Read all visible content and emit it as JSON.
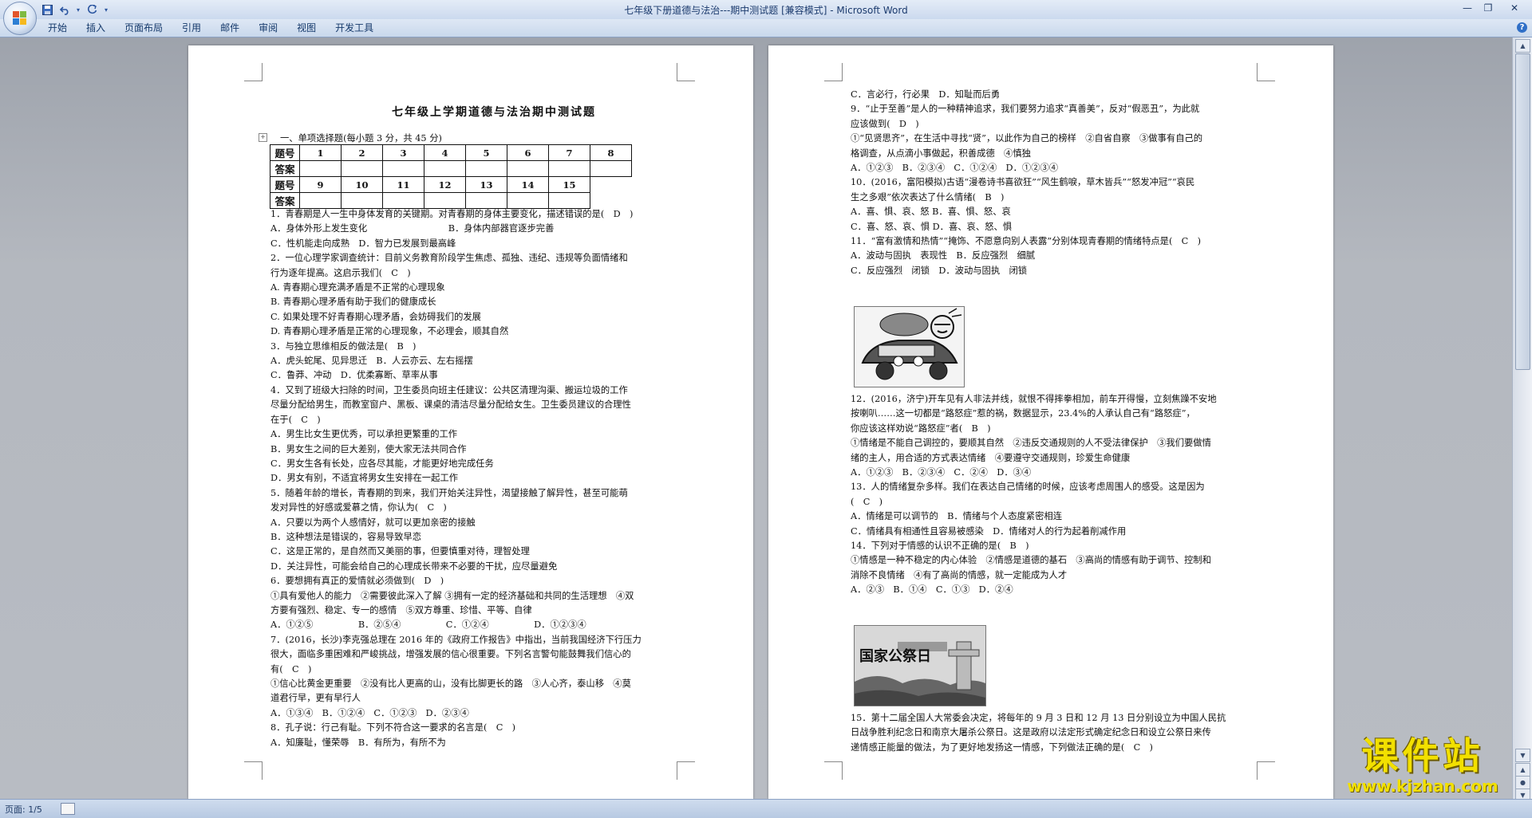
{
  "window": {
    "title": "七年级下册道德与法治---期中测试题 [兼容模式] - Microsoft Word"
  },
  "ribbon": {
    "tabs": [
      {
        "label": "开始"
      },
      {
        "label": "插入"
      },
      {
        "label": "页面布局"
      },
      {
        "label": "引用"
      },
      {
        "label": "邮件"
      },
      {
        "label": "审阅"
      },
      {
        "label": "视图"
      },
      {
        "label": "开发工具"
      }
    ]
  },
  "document": {
    "title": "七年级上学期道德与法治期中测试题",
    "section_heading": "一、单项选择题(每小题 3 分，共 45 分)",
    "answer_table": {
      "row1_header": "题号",
      "row2_header": "答案",
      "row3_header": "题号",
      "row4_header": "答案",
      "numbers_row1": [
        "1",
        "2",
        "3",
        "4",
        "5",
        "6",
        "7",
        "8"
      ],
      "numbers_row2": [
        "9",
        "10",
        "11",
        "12",
        "13",
        "14",
        "15"
      ]
    },
    "left_page_lines": [
      "1．青春期是人一生中身体发育的关键期。对青春期的身体主要变化，描述错误的是(　D　)",
      "A．身体外形上发生变化　　　　　　　　　B．身体内部器官逐步完善",
      "C．性机能走向成熟　D．智力已发展到最高峰",
      "2．一位心理学家调查统计：目前义务教育阶段学生焦虑、孤独、违纪、违规等负面情绪和",
      "行为逐年提高。这启示我们(　C　)",
      "A. 青春期心理充满矛盾是不正常的心理现象",
      "B. 青春期心理矛盾有助于我们的健康成长",
      "C. 如果处理不好青春期心理矛盾，会妨碍我们的发展",
      "D. 青春期心理矛盾是正常的心理现象，不必理会，顺其自然",
      "3．与独立思维相反的做法是(　B　)",
      "A．虎头蛇尾、见异思迁　B．人云亦云、左右摇摆",
      "C．鲁莽、冲动　D．优柔寡断、草率从事",
      "4．又到了班级大扫除的时间，卫生委员向班主任建议：公共区清理沟渠、搬运垃圾的工作",
      "尽量分配给男生，而教室窗户、黑板、课桌的清洁尽量分配给女生。卫生委员建议的合理性",
      "在于(　C　)",
      "A．男生比女生更优秀，可以承担更繁重的工作",
      "B．男女生之间的巨大差别，使大家无法共同合作",
      "C．男女生各有长处，应各尽其能，才能更好地完成任务",
      "D．男女有别，不适宜将男女生安排在一起工作",
      "5．随着年龄的增长，青春期的到来，我们开始关注异性，渴望接触了解异性，甚至可能萌",
      "发对异性的好感或爱慕之情，你认为(　C　)",
      "A．只要以为两个人感情好，就可以更加亲密的接触",
      "B．这种想法是错误的，容易导致早恋",
      "C．这是正常的，是自然而又美丽的事，但要慎重对待，理智处理",
      "D．关注异性，可能会给自己的心理成长带来不必要的干扰，应尽量避免",
      "6．要想拥有真正的爱情就必须做到(　D　)",
      "①具有爱他人的能力　②需要彼此深入了解 ③拥有一定的经济基础和共同的生活理想　④双",
      "方要有强烈、稳定、专一的感情　⑤双方尊重、珍惜、平等、自律",
      "A．①②⑤　　　　　B．②⑤④　　　　　C．①②④　　　　　D．①②③④",
      "7．(2016，长沙)李克强总理在 2016 年的《政府工作报告》中指出，当前我国经济下行压力",
      "很大，面临多重困难和严峻挑战，增强发展的信心很重要。下列名言警句能鼓舞我们信心的",
      "有(　C　)",
      "①信心比黄金更重要　②没有比人更高的山，没有比脚更长的路　③人心齐，泰山移　④莫",
      "道君行早，更有早行人",
      "A．①③④　B．①②④　C．①②③　D．②③④",
      "8．孔子说：行己有耻。下列不符合这一要求的名言是(　C　)",
      "A．知廉耻，懂荣辱　B．有所为，有所不为"
    ],
    "right_page_lines_a": [
      "C．言必行，行必果　D．知耻而后勇",
      "9．“止于至善”是人的一种精神追求，我们要努力追求“真善美”，反对“假恶丑”，为此就",
      "应该做到(　D　)",
      "①“见贤思齐”，在生活中寻找“贤”，以此作为自己的榜样　②自省自察　③做事有自己的",
      "格调查，从点滴小事做起，积善成德　④慎独",
      "A．①②③　B．②③④　C．①②④　D．①②③④",
      "10．(2016，富阳模拟)古语“漫卷诗书喜欲狂”“风生鹤唳，草木皆兵”“怒发冲冠”“哀民",
      "生之多艰”依次表达了什么情绪(　B　)",
      "A．喜、惧、哀、怒 B．喜、惧、怒、哀",
      "C．喜、怒、哀、惧 D．喜、哀、怒、惧",
      "11．“富有激情和热情”“掩饰、不愿意向别人表露”分别体现青春期的情绪特点是(　C　)",
      "A．波动与固执　表现性　B．反应强烈　细腻",
      "C．反应强烈　闭锁　D．波动与固执　闭锁"
    ],
    "right_page_lines_b": [
      "12．(2016，济宁)开车见有人非法并线，就恨不得摔拳相加，前车开得慢，立刻焦躁不安地",
      "按喇叭……这一切都是“路怒症”惹的祸，数据显示，23.4%的人承认自己有“路怒症”，",
      "你应该这样劝说“路怒症”者(　B　)",
      "①情绪是不能自己调控的，要顺其自然　②违反交通规则的人不受法律保护　③我们要做情",
      "绪的主人，用合适的方式表达情绪　④要遵守交通规则，珍爱生命健康",
      "A．①②③　B．②③④　C．②④　D．③④",
      "13．人的情绪复杂多样。我们在表达自己情绪的时候，应该考虑周围人的感受。这是因为",
      "(　C　)",
      "A．情绪是可以调节的　B．情绪与个人态度紧密相连",
      "C．情绪具有相通性且容易被感染　D．情绪对人的行为起着削减作用",
      "14．下列对于情感的认识不正确的是(　B　)",
      "①情感是一种不稳定的内心体验　②情感是道德的基石　③高尚的情感有助于调节、控制和",
      "消除不良情绪　④有了高尚的情感，就一定能成为人才",
      "A．②③　B．①④　C．①③　D．②④"
    ],
    "right_page_lines_c": [
      "15．第十二届全国人大常委会决定，将每年的 9 月 3 日和 12 月 13 日分别设立为中国人民抗",
      "日战争胜利纪念日和南京大屠杀公祭日。这是政府以法定形式确定纪念日和设立公祭日来传",
      "递情感正能量的做法，为了更好地发扬这一情感，下列做法正确的是(　C　)"
    ],
    "figure2_text": "国家公祭日"
  },
  "status": {
    "page_info": "页面: 1/5"
  },
  "watermark": {
    "title": "课件站",
    "url": "www.kjzhan.com"
  },
  "colors": {
    "ribbon_bg": "#c9d8ec",
    "title_text": "#1c3b6e",
    "workspace_bg": "#b4b8bf",
    "watermark_yellow": "#f2e000"
  }
}
